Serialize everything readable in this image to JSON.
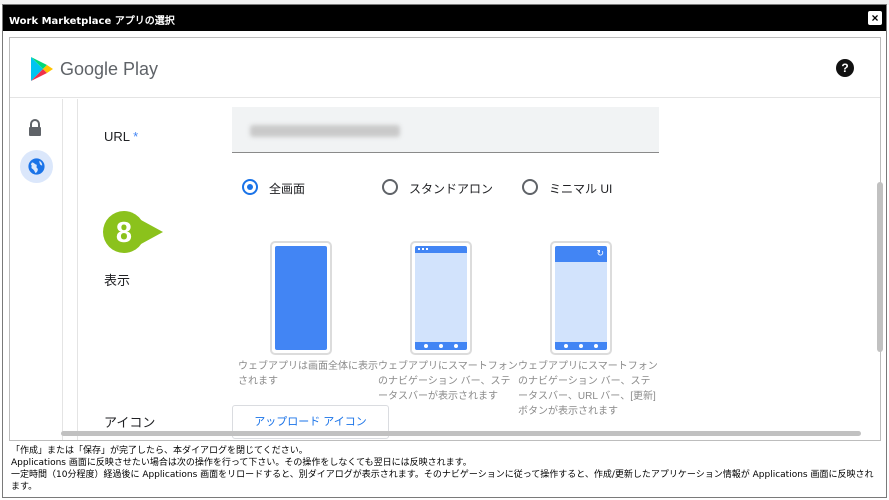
{
  "dialog": {
    "title": "Work Marketplace アプリの選択",
    "close_icon": "close-icon"
  },
  "header": {
    "brand": "Google Play",
    "logo_icon": "google-play-icon",
    "help_icon": "help-icon",
    "help_glyph": "?"
  },
  "leftnav": {
    "items": [
      {
        "icon": "lock-icon",
        "selected": false
      },
      {
        "icon": "globe-icon",
        "selected": true
      }
    ]
  },
  "form": {
    "url_label": "URL",
    "required_mark": "*",
    "display_label": "表示",
    "step_badge": "8",
    "display_options": [
      {
        "label": "全画面",
        "selected": true,
        "description": "ウェブアプリは画面全体に表示されます"
      },
      {
        "label": "スタンドアロン",
        "selected": false,
        "description": "ウェブアプリにスマートフォンのナビゲーション バー、ステータスバーが表示されます"
      },
      {
        "label": "ミニマル UI",
        "selected": false,
        "description": "ウェブアプリにスマートフォンのナビゲーション バー、ステータスバー、URL バー、[更新] ボタンが表示されます"
      }
    ],
    "icon_label": "アイコン",
    "upload_button": "アップロード アイコン"
  },
  "notes": [
    "「作成」または「保存」が完了したら、本ダイアログを閉じてください。",
    "Applications 画面に反映させたい場合は次の操作を行って下さい。その操作をしなくても翌日には反映されます。",
    "一定時間（10分程度）経過後に Applications 画面をリロードすると、別ダイアログが表示されます。そのナビゲーションに従って操作すると、作成/更新したアプリケーション情報が Applications 画面に反映されます。"
  ],
  "colors": {
    "accent": "#1a73e8",
    "badge": "#8bc21c",
    "phone_screen": "#d2e3fc",
    "phone_bar": "#4285f4"
  }
}
